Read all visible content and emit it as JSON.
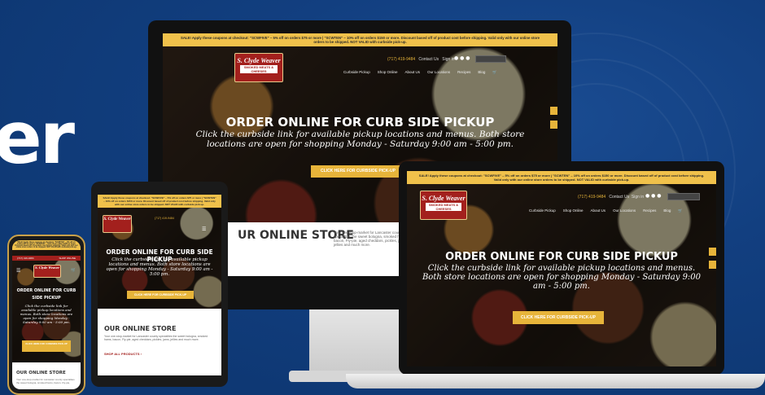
{
  "hero_word": "er",
  "promo": "SALE! Apply these coupons at checkout: \"SCWFIVE\" – 5% off on orders $75 or more | \"SCWTEN\" – 10% off on orders $150 or more. Discount based off of product cost before shipping. Valid only with our online store orders to be shipped. NOT VALID with curbside pick-up.",
  "phone_number": "(717) 419-9484",
  "links": {
    "contact": "Contact Us",
    "signin": "Sign in"
  },
  "nav": [
    "Curbside Pickup",
    "Shop Online",
    "About Us",
    "Our Locations",
    "Recipes",
    "Blog"
  ],
  "logo": {
    "name": "S. Clyde Weaver",
    "tag": "SMOKED MEATS & CHEESES"
  },
  "hero": {
    "title": "ORDER ONLINE FOR CURB SIDE PICKUP",
    "subtitle": "Click the curbside link for available pickup locations and menus. Both store locations are open for shopping Monday - Saturday 9:00 am - 5:00 pm.",
    "monitor_cta": "CLICK HERE FOR CURBSIDE PICK-UP",
    "laptop_cta": "CLICK HERE FOR CURBSIDE PICK-UP",
    "tablet_cta": "CLICK HERE FOR CURBSIDE PICK-UP",
    "phone_cta": "CLICK HERE FOR CURBSIDE PICK-UP",
    "tablet_title": "ORDER ONLINE FOR CURB SIDE PICKUP",
    "phone_title": "ORDER ONLINE FOR CURB SIDE PICKUP"
  },
  "store": {
    "title": "OUR ONLINE STORE",
    "monitor_title": "UR ONLINE STORE",
    "desc": "Your one-stop-market for Lancaster county specialties the sweet bologna, smoked hams, bacon, Fly-pie, aged cheddars, pickles, jams, jellies and much more.",
    "shop_all": "SHOP ALL PRODUCTS ›"
  },
  "phone_top": {
    "left": "(717) 419-9484",
    "right": "SHOP ONLINE"
  },
  "colors": {
    "brand_red": "#a3201d",
    "accent_gold": "#e7b43a",
    "bg_blue": "#0f3a78"
  }
}
